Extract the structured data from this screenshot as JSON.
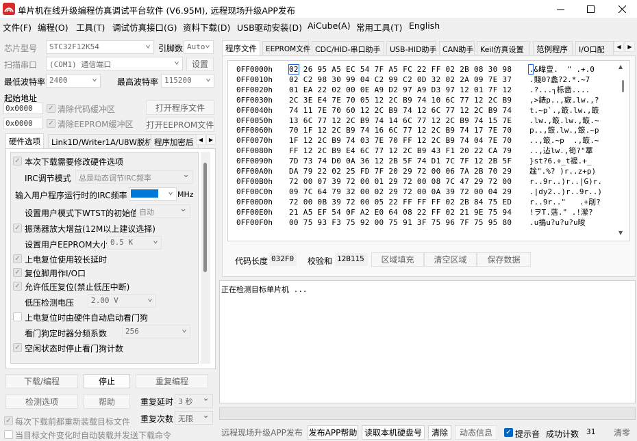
{
  "window": {
    "title": "单片机在线升级编程仿真调试平台软件 (V6.95M), 远程现场升级APP发布"
  },
  "menu": [
    "文件(F)",
    "编程(O)",
    "工具(T)",
    "调试仿真接口(G)",
    "资料下载(D)",
    "USB驱动安装(D)",
    "AiCube(A)",
    "常用工具(T)",
    "English"
  ],
  "left": {
    "chip_label": "芯片型号",
    "chip_value": "STC32F12K54",
    "pins_label": "引脚数",
    "pins_value": "Auto",
    "scan_port_label": "扫描串口",
    "port_value": "(COM1) 通信端口",
    "settings_btn": "设置",
    "min_baud_label": "最低波特率",
    "min_baud_value": "2400",
    "max_baud_label": "最高波特率",
    "max_baud_value": "115200",
    "start_addr_label": "起始地址",
    "addr1": "0x0000",
    "clear_code_label": "清除代码缓冲区",
    "open_program_btn": "打开程序文件",
    "addr2": "0x0000",
    "clear_eeprom_label": "清除EEPROM缓冲区",
    "open_eeprom_btn": "打开EEPROM文件",
    "tabs": [
      "硬件选项",
      "Link1D/Writer1A/U8W脱机",
      "程序加密后"
    ],
    "hw": {
      "opt1": "本次下载需要修改硬件选项",
      "irc_mode_label": "IRC调节模式",
      "irc_mode_value": "总是动态调节IRC频率",
      "irc_freq_label": "输入用户程序运行时的IRC频率",
      "irc_freq_unit": "MHz",
      "wtst_label": "设置用户模式下WTST的初始值",
      "wtst_value": "自动",
      "opt2": "振荡器放大增益(12M以上建议选择)",
      "eeprom_size_label": "设置用户EEPROM大小",
      "eeprom_size_value": "0.5 K",
      "opt3": "上电复位使用较长延时",
      "opt4": "复位脚用作I/O口",
      "opt5": "允许低压复位(禁止低压中断)",
      "lvd_label": "低压检测电压",
      "lvd_value": "2.00 V",
      "opt6": "上电复位时由硬件自动启动看门狗",
      "wdt_label": "看门狗定时器分频系数",
      "wdt_value": "256",
      "opt7": "空闲状态时停止看门狗计数"
    },
    "download_btn": "下载/编程",
    "stop_btn": "停止",
    "reprogram_btn": "重复编程",
    "detect_btn": "检测选项",
    "help_btn": "帮助",
    "repeat_delay_label": "重复延时",
    "repeat_delay_value": "3 秒",
    "repeat_count_label": "重复次数",
    "repeat_count_value": "无限",
    "reload_label": "每次下载前都重新装载目标文件",
    "autoload_label": "当目标文件变化时自动装载并发送下载命令"
  },
  "right": {
    "tabs": [
      "程序文件",
      "EEPROM文件",
      "CDC/HID-串口助手",
      "USB-HID助手",
      "CAN助手",
      "Keil仿真设置",
      "范例程序",
      "I/O口配"
    ],
    "hex_rows": [
      {
        "addr": "0FF0000h",
        "bytes": "02 26 95 A5 EC 54 7F A5 FC 22 FF 02 2B 08 30 98",
        "ascii": ".&暐亶.  \" .+.0"
      },
      {
        "addr": "0FF0010h",
        "bytes": "02 C2 98 30 99 04 C2 99 C2 0D 32 02 2A 09 7E 37",
        "ascii": ".賤0?蠡?2.*.~7"
      },
      {
        "addr": "0FF0020h",
        "bytes": "01 EA 22 02 00 0E A9 D2 97 A9 D3 97 12 01 7F 12",
        "ascii": ".?...┐栎啬...."
      },
      {
        "addr": "0FF0030h",
        "bytes": "2C 3E E4 7E 70 05 12 2C B9 74 10 6C 77 12 2C B9",
        "ascii": ",>錶p..,窽.lw.,?"
      },
      {
        "addr": "0FF0040h",
        "bytes": "74 11 7E 70 60 12 2C B9 74 12 6C 77 12 2C B9 74",
        "ascii": "t.~p`.,箃.lw.,箃"
      },
      {
        "addr": "0FF0050h",
        "bytes": "13 6C 77 12 2C B9 74 14 6C 77 12 2C B9 74 15 7E",
        "ascii": ".lw.,箃.lw.,箃.~"
      },
      {
        "addr": "0FF0060h",
        "bytes": "70 1F 12 2C B9 74 16 6C 77 12 2C B9 74 17 7E 70",
        "ascii": "p..,箃.lw.,箃.~p"
      },
      {
        "addr": "0FF0070h",
        "bytes": "1F 12 2C B9 74 03 7E 70 FF 12 2C B9 74 04 7E 70",
        "ascii": "..,箃.~p  .,箃.~"
      },
      {
        "addr": "0FF0080h",
        "bytes": "FF 12 2C B9 E4 6C 77 12 2C B9 43 F1 20 22 CA 79",
        "ascii": "..,迠lw.,筍?\"蕐"
      },
      {
        "addr": "0FF0090h",
        "bytes": "7D 73 74 D0 0A 36 12 2B 5F 74 D1 7C 7F 12 2B 5F",
        "ascii": "}st?6.+_t褆.+_"
      },
      {
        "addr": "0FF00A0h",
        "bytes": "DA 79 22 02 25 FD 7F 20 29 72 00 06 7A 2B 70 29",
        "ascii": "趛\".%? )r..z+p)"
      },
      {
        "addr": "0FF00B0h",
        "bytes": "72 00 07 39 72 00 01 29 72 00 08 7C 47 29 72 00",
        "ascii": "r..9r..)r..|G)r."
      },
      {
        "addr": "0FF00C0h",
        "bytes": "09 7C 64 79 32 00 02 29 72 00 0A 39 72 00 04 29",
        "ascii": ".|dy2..)r..9r..)"
      },
      {
        "addr": "0FF00D0h",
        "bytes": "72 00 0B 39 72 00 05 22 FF FF FF 02 2B 84 75 ED",
        "ascii": "r..9r..\"   .+剈?"
      },
      {
        "addr": "0FF00E0h",
        "bytes": "21 A5 EF 54 0F A2 E0 64 08 22 FF 02 21 9E 75 94",
        "ascii": "!ヲT.萿.\" .!瀠?"
      },
      {
        "addr": "0FF00F0h",
        "bytes": "00 75 93 F3 75 92 00 75 91 3F 75 96 7F 75 95 80",
        "ascii": ".u搗u?u?u?u晙"
      }
    ],
    "code_len_label": "代码长度",
    "code_len_value": "032F0",
    "checksum_label": "校验和",
    "checksum_value": "12B115",
    "fill_btn": "区域填充",
    "clear_btn": "清空区域",
    "save_btn": "保存数据",
    "log_text": "正在检测目标单片机 ...",
    "bottom": {
      "remote_btn": "远程现场升级APP发布",
      "help_app_btn": "发布APP帮助",
      "read_disk_btn": "读取本机硬盘号",
      "clear_btn": "清除",
      "dyn_info_btn": "动态信息",
      "beep_label": "提示音",
      "success_label": "成功计数",
      "success_value": "31",
      "reset_btn": "清零"
    }
  }
}
